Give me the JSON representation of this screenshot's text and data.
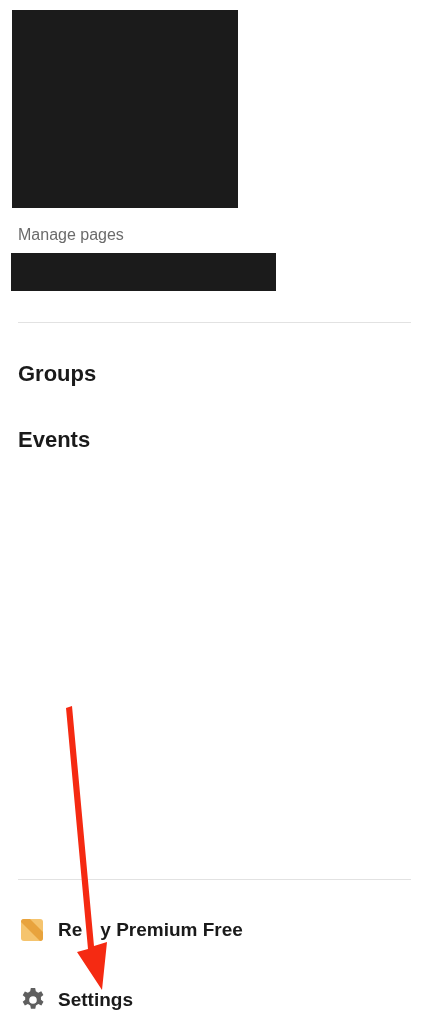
{
  "manage_pages_label": "Manage pages",
  "nav_items": [
    {
      "label": "Groups"
    },
    {
      "label": "Events"
    }
  ],
  "footer_items": [
    {
      "kind": "premium",
      "label_parts": [
        "Re",
        "y Premium Free"
      ]
    },
    {
      "kind": "settings",
      "label_parts": [
        "Settings"
      ]
    }
  ]
}
